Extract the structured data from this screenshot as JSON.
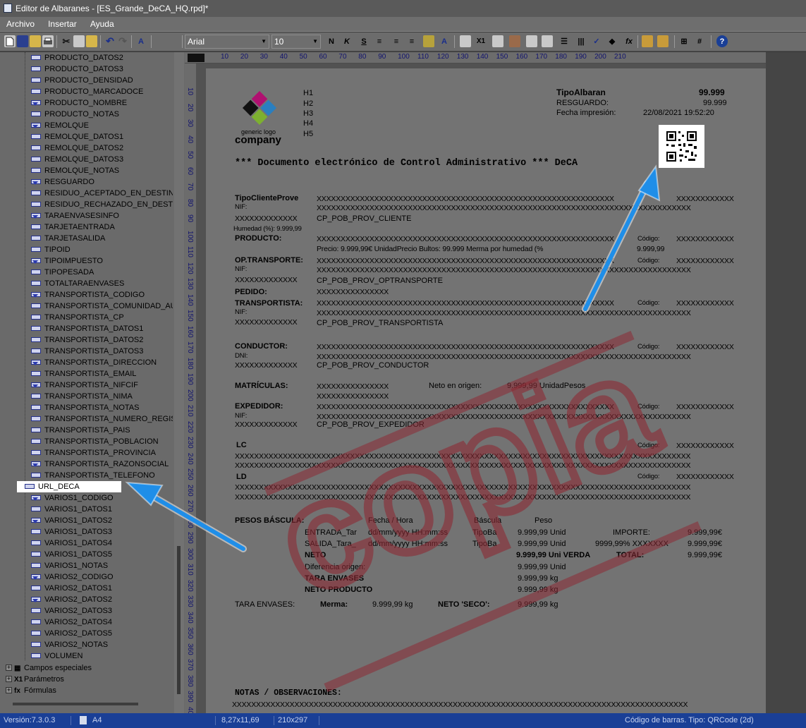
{
  "window": {
    "title": "Editor de Albaranes - [ES_Grande_DeCA_HQ.rpd]*"
  },
  "menu": [
    "Archivo",
    "Insertar",
    "Ayuda"
  ],
  "toolbar": {
    "font_name": "Arial",
    "font_size": "10",
    "bold_label": "N",
    "italic_label": "K",
    "underline_label": "S"
  },
  "tree": {
    "fields": [
      "PRODUCTO_DATOS2",
      "PRODUCTO_DATOS3",
      "PRODUCTO_DENSIDAD",
      "PRODUCTO_MARCADOCE",
      "PRODUCTO_NOMBRE",
      "PRODUCTO_NOTAS",
      "REMOLQUE",
      "REMOLQUE_DATOS1",
      "REMOLQUE_DATOS2",
      "REMOLQUE_DATOS3",
      "REMOLQUE_NOTAS",
      "RESGUARDO",
      "RESIDUO_ACEPTADO_EN_DESTINO",
      "RESIDUO_RECHAZADO_EN_DESTINO",
      "TARAENVASESINFO",
      "TARJETAENTRADA",
      "TARJETASALIDA",
      "TIPOID",
      "TIPOIMPUESTO",
      "TIPOPESADA",
      "TOTALTARAENVASES",
      "TRANSPORTISTA_CODIGO",
      "TRANSPORTISTA_COMUNIDAD_AUT",
      "TRANSPORTISTA_CP",
      "TRANSPORTISTA_DATOS1",
      "TRANSPORTISTA_DATOS2",
      "TRANSPORTISTA_DATOS3",
      "TRANSPORTISTA_DIRECCION",
      "TRANSPORTISTA_EMAIL",
      "TRANSPORTISTA_NIFCIF",
      "TRANSPORTISTA_NIMA",
      "TRANSPORTISTA_NOTAS",
      "TRANSPORTISTA_NUMERO_REGISTR",
      "TRANSPORTISTA_PAIS",
      "TRANSPORTISTA_POBLACION",
      "TRANSPORTISTA_PROVINCIA",
      "TRANSPORTISTA_RAZONSOCIAL",
      "TRANSPORTISTA_TELEFONO",
      "URL_DECA",
      "VARIOS1_CODIGO",
      "VARIOS1_DATOS1",
      "VARIOS1_DATOS2",
      "VARIOS1_DATOS3",
      "VARIOS1_DATOS4",
      "VARIOS1_DATOS5",
      "VARIOS1_NOTAS",
      "VARIOS2_CODIGO",
      "VARIOS2_DATOS1",
      "VARIOS2_DATOS2",
      "VARIOS2_DATOS3",
      "VARIOS2_DATOS4",
      "VARIOS2_DATOS5",
      "VARIOS2_NOTAS",
      "VOLUMEN"
    ],
    "selected": "URL_DECA",
    "groups": [
      "Campos especiales",
      "Parámetros",
      "Fórmulas"
    ]
  },
  "ruler": {
    "h": [
      "10",
      "20",
      "30",
      "40",
      "50",
      "60",
      "70",
      "80",
      "90",
      "100",
      "110",
      "120",
      "130",
      "140",
      "150",
      "160",
      "170",
      "180",
      "190",
      "200",
      "210"
    ],
    "v": [
      "10",
      "20",
      "30",
      "40",
      "50",
      "60",
      "70",
      "80",
      "90",
      "100",
      "110",
      "120",
      "130",
      "140",
      "150",
      "160",
      "170",
      "180",
      "190",
      "200",
      "210",
      "220",
      "230",
      "240",
      "250",
      "260",
      "270",
      "280",
      "290",
      "300",
      "310",
      "320",
      "330",
      "340",
      "350",
      "360",
      "370",
      "380",
      "390",
      "400"
    ]
  },
  "doc": {
    "logo_generic": "generic logo",
    "logo_company": "company",
    "h": [
      "H1",
      "H2",
      "H3",
      "H4",
      "H5"
    ],
    "tipo_albaran": "TipoAlbaran",
    "tipo_albaran_val": "99.999",
    "resguardo": "RESGUARDO:",
    "resguardo_val": "99.999",
    "fecha_imp": "Fecha impresión:",
    "fecha_imp_val": "22/08/2021 19:52:20",
    "title": "*** Documento electrónico de Control Administrativo *** DeCA",
    "watermark": "copia",
    "tipo_cliente": "TipoClienteProve",
    "nif": "NIF:",
    "dni": "DNI:",
    "xshort": "XXXXXXXXXXXXX",
    "xmed": "XXXXXXXXXXXXXXX",
    "xlong": "XXXXXXXXXXXXXXXXXXXXXXXXXXXXXXXXXXXXXXXXXXXXXXXXXXXXXXXXXXXXXX",
    "xlong2": "XXXXXXXXXXXXXXXXXXXXXXXXXXXXXXXXXXXXXXXXXXXXXXXXXXXXXXXXXXXXXXXXXXXXXXXXXXXXXX",
    "xfull": "XXXXXXXXXXXXXXXXXXXXXXXXXXXXXXXXXXXXXXXXXXXXXXXXXXXXXXXXXXXXXXXXXXXXXXXXXXXXXXXXXXXXXXXXXXXXXXX",
    "xcode": "XXXXXXXXXXXX",
    "codigo": "Código:",
    "cp_cliente": "CP_POB_PROV_CLIENTE",
    "humedad": "Humedad (%):  9.999,99",
    "producto": "PRODUCTO:",
    "precio_line": "Precio:  9.999,99€ UnidadPrecio     Bultos:  99.999      Merma por humedad (%",
    "merma_val": "9.999,99",
    "op_transporte": "OP.TRANSPORTE:",
    "cp_optrans": "CP_POB_PROV_OPTRANSPORTE",
    "pedido": "PEDIDO:",
    "transportista": "TRANSPORTISTA:",
    "cp_trans": "CP_POB_PROV_TRANSPORTISTA",
    "conductor": "CONDUCTOR:",
    "cp_conductor": "CP_POB_PROV_CONDUCTOR",
    "matriculas": "MATRÍCULAS:",
    "neto_origen": "Neto en origen:",
    "neto_origen_val": "9.999,99 UnidadPesos",
    "expedidor": "EXPEDIDOR:",
    "cp_expedidor": "CP_POB_PROV_EXPEDIDOR",
    "lc": "LC",
    "ld": "LD",
    "pesos": "PESOS BÁSCULA:",
    "fecha_hora": "Fecha / Hora",
    "bascula": "Báscula",
    "peso": "Peso",
    "entrada": "ENTRADA_Tar",
    "salida": "SALIDA_Tara_",
    "datefmt": "dd/mm/yyyy HH:mm:ss",
    "tipoba": "TipoBa",
    "val_unid": "9.999,99 Unid",
    "importe": "IMPORTE:",
    "money": "9.999,99€",
    "pct": "9999,99% XXXXXXX",
    "neto": "NETO",
    "neto_val": "9.999,99 Uni VERDA",
    "total": "TOTAL:",
    "dif_origen": "Diferencia origen:",
    "tara_envases": "TARA ENVASES",
    "kg_val": "9.999,99  kg",
    "neto_producto": "NETO PRODUCTO",
    "tara_env2": "TARA ENVASES:",
    "merma": "Merma:",
    "neto_seco": "NETO 'SECO':",
    "notas": "NOTAS / OBSERVACIONES:"
  },
  "status": {
    "version": "Versión:7.3.0.3",
    "paper": "A4",
    "inches": "8,27x11,69",
    "mm": "210x297",
    "hint": "Código de barras. Tipo: QRCode (2d)"
  }
}
